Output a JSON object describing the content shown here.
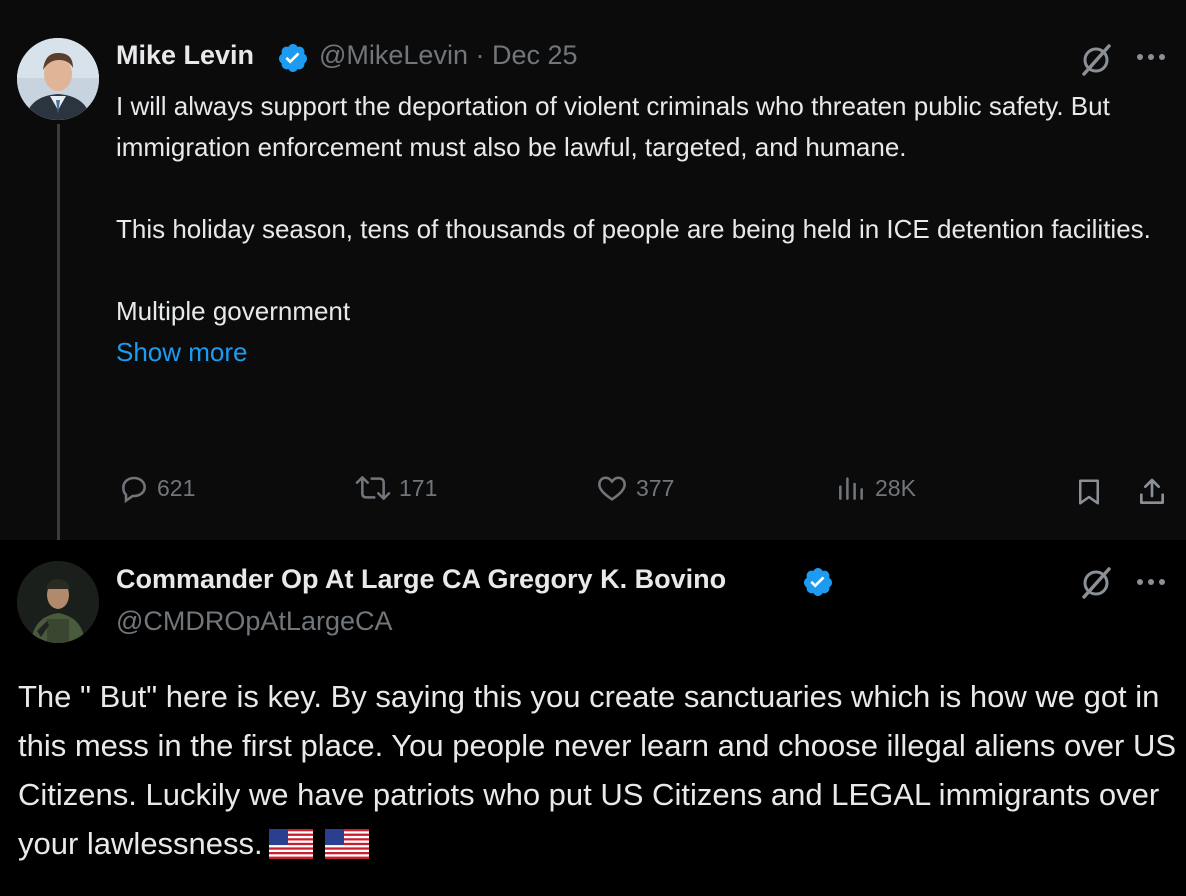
{
  "colors": {
    "accent": "#1d9bf0",
    "muted": "#71767b",
    "text": "#e7e9ea",
    "background": "#000000"
  },
  "post1": {
    "author_name": "Mike Levin",
    "handle_date": "@MikeLevin · Dec 25",
    "paragraphs": [
      "I will always support the deportation of violent criminals who threaten public safety. But immigration enforcement must also be lawful, targeted, and humane.",
      "This holiday season, tens of thousands of people are being held in ICE detention facilities.",
      "Multiple government"
    ],
    "show_more": "Show more",
    "replies": "621",
    "reposts": "171",
    "likes": "377",
    "views": "28K",
    "icons": [
      "grok-icon",
      "more-icon",
      "reply-icon",
      "repost-icon",
      "like-icon",
      "views-icon",
      "bookmark-icon",
      "share-icon",
      "verified-icon"
    ]
  },
  "post2": {
    "author_name": "Commander Op At Large CA Gregory K. Bovino",
    "handle": "@CMDROpAtLargeCA",
    "text": "The \" But\" here is key.  By saying this you create sanctuaries which is how we got in this mess in the first place.  You people never learn and choose illegal aliens over US Citizens.  Luckily we have patriots who put US Citizens and LEGAL immigrants over your lawlessness.",
    "emoji": [
      "us-flag-emoji",
      "us-flag-emoji"
    ]
  }
}
